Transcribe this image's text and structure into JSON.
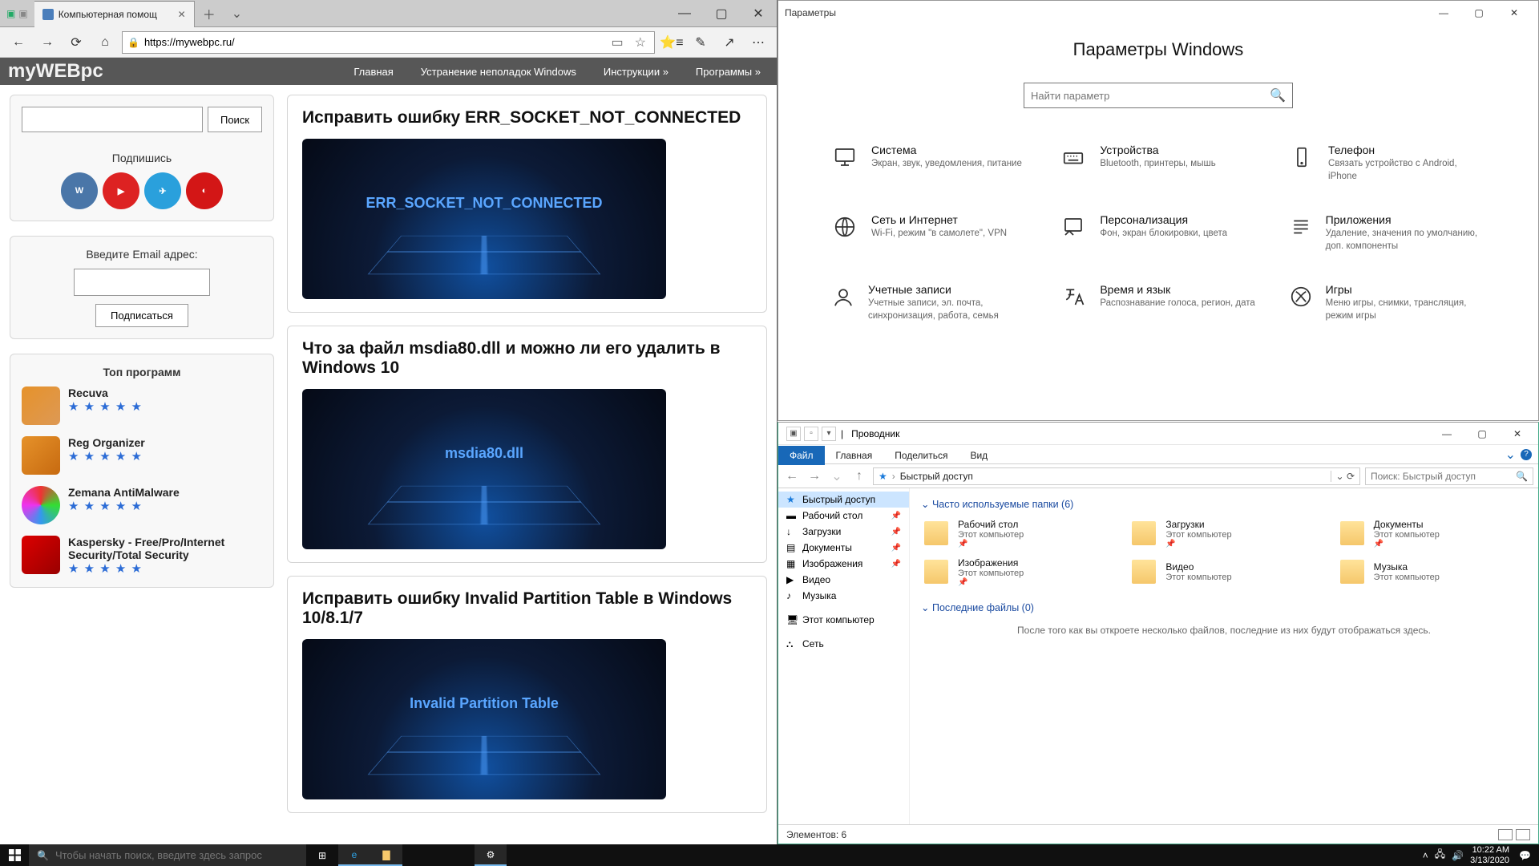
{
  "edge": {
    "tab_title": "Компьютерная помощ",
    "url": "https://mywebpc.ru/",
    "nav": {
      "back": "←",
      "fwd": "→",
      "reload": "⟳",
      "home": "⌂"
    },
    "toolbar": {
      "reading": "▭",
      "fav": "☆",
      "favlist": "⭐≡",
      "notes": "✎",
      "share": "↗",
      "more": "⋯"
    },
    "win": {
      "min": "—",
      "max": "▢",
      "close": "✕"
    }
  },
  "site": {
    "logo": "myWEBpc",
    "nav": [
      "Главная",
      "Устранение неполадок Windows",
      "Инструкции »",
      "Программы »"
    ],
    "search_btn": "Поиск",
    "subscribe_hdr": "Подпишись",
    "email_label": "Введите Email адрес:",
    "email_btn": "Подписаться",
    "top_hdr": "Топ программ",
    "progs": [
      {
        "name": "Recuva"
      },
      {
        "name": "Reg Organizer"
      },
      {
        "name": "Zemana AntiMalware"
      },
      {
        "name": "Kaspersky - Free/Pro/Internet Security/Total Security"
      }
    ],
    "articles": [
      {
        "title": "Исправить ошибку ERR_SOCKET_NOT_CONNECTED",
        "thumb": "ERR_SOCKET_NOT_CONNECTED"
      },
      {
        "title": "Что за файл msdia80.dll и можно ли его удалить в Windows 10",
        "thumb": "msdia80.dll"
      },
      {
        "title": "Исправить ошибку Invalid Partition Table в Windows 10/8.1/7",
        "thumb": "Invalid Partition Table"
      }
    ]
  },
  "settings": {
    "wintitle": "Параметры",
    "heading": "Параметры Windows",
    "search_placeholder": "Найти параметр",
    "items": [
      {
        "t": "Система",
        "d": "Экран, звук, уведомления, питание"
      },
      {
        "t": "Устройства",
        "d": "Bluetooth, принтеры, мышь"
      },
      {
        "t": "Телефон",
        "d": "Связать устройство с Android, iPhone"
      },
      {
        "t": "Сеть и Интернет",
        "d": "Wi-Fi, режим \"в самолете\", VPN"
      },
      {
        "t": "Персонализация",
        "d": "Фон, экран блокировки, цвета"
      },
      {
        "t": "Приложения",
        "d": "Удаление, значения по умолчанию, доп. компоненты"
      },
      {
        "t": "Учетные записи",
        "d": "Учетные записи, эл. почта, синхронизация, работа, семья"
      },
      {
        "t": "Время и язык",
        "d": "Распознавание голоса, регион, дата"
      },
      {
        "t": "Игры",
        "d": "Меню игры, снимки, трансляция, режим игры"
      }
    ],
    "win": {
      "min": "—",
      "max": "▢",
      "close": "✕"
    }
  },
  "explorer": {
    "title": "Проводник",
    "ribbon": {
      "file": "Файл",
      "home": "Главная",
      "share": "Поделиться",
      "view": "Вид"
    },
    "path_label": "Быстрый доступ",
    "search_placeholder": "Поиск: Быстрый доступ",
    "nav": [
      {
        "label": "Быстрый доступ",
        "sel": true,
        "glyph": "★"
      },
      {
        "label": "Рабочий стол",
        "pin": true,
        "glyph": "▬"
      },
      {
        "label": "Загрузки",
        "pin": true,
        "glyph": "↓"
      },
      {
        "label": "Документы",
        "pin": true,
        "glyph": "▤"
      },
      {
        "label": "Изображения",
        "pin": true,
        "glyph": "▦"
      },
      {
        "label": "Видео",
        "glyph": "▶"
      },
      {
        "label": "Музыка",
        "glyph": "♪"
      }
    ],
    "nav2": [
      {
        "label": "Этот компьютер",
        "glyph": "🖥"
      },
      {
        "label": "Сеть",
        "glyph": "⛬"
      }
    ],
    "section_freq": "Часто используемые папки (6)",
    "folders": [
      {
        "n": "Рабочий стол",
        "s": "Этот компьютер",
        "pin": true
      },
      {
        "n": "Загрузки",
        "s": "Этот компьютер",
        "pin": true
      },
      {
        "n": "Документы",
        "s": "Этот компьютер",
        "pin": true
      },
      {
        "n": "Изображения",
        "s": "Этот компьютер",
        "pin": true
      },
      {
        "n": "Видео",
        "s": "Этот компьютер"
      },
      {
        "n": "Музыка",
        "s": "Этот компьютер"
      }
    ],
    "section_recent": "Последние файлы (0)",
    "recent_empty": "После того как вы откроете несколько файлов, последние из них будут отображаться здесь.",
    "status": "Элементов: 6",
    "win": {
      "min": "—",
      "max": "▢",
      "close": "✕"
    }
  },
  "taskbar": {
    "search_placeholder": "Чтобы начать поиск, введите здесь запрос",
    "time": "10:22 AM",
    "date": "3/13/2020"
  }
}
